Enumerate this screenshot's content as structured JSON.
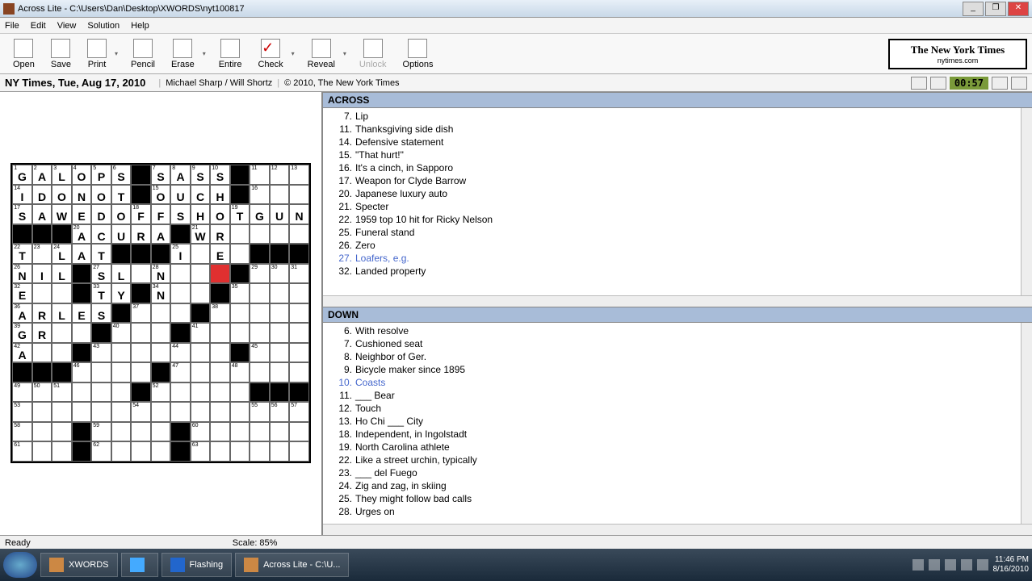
{
  "title": "Across Lite - C:\\Users\\Dan\\Desktop\\XWORDS\\nyt100817",
  "menu": [
    "File",
    "Edit",
    "View",
    "Solution",
    "Help"
  ],
  "tools": {
    "open": "Open",
    "save": "Save",
    "print": "Print",
    "pencil": "Pencil",
    "erase": "Erase",
    "entire": "Entire",
    "check": "Check",
    "reveal": "Reveal",
    "unlock": "Unlock",
    "options": "Options"
  },
  "logo": {
    "top": "The New York Times",
    "sub": "nytimes.com"
  },
  "info": {
    "title": "NY Times, Tue, Aug 17, 2010",
    "author": "Michael Sharp / Will Shortz",
    "copyright": "© 2010, The New York Times",
    "timer": "00:57"
  },
  "across_label": "ACROSS",
  "down_label": "DOWN",
  "across": [
    {
      "n": "7",
      "t": "Lip"
    },
    {
      "n": "11",
      "t": "Thanksgiving side dish"
    },
    {
      "n": "14",
      "t": "Defensive statement"
    },
    {
      "n": "15",
      "t": "\"That hurt!\""
    },
    {
      "n": "16",
      "t": "It's a cinch, in Sapporo"
    },
    {
      "n": "17",
      "t": "Weapon for Clyde Barrow"
    },
    {
      "n": "20",
      "t": "Japanese luxury auto"
    },
    {
      "n": "21",
      "t": "Specter"
    },
    {
      "n": "22",
      "t": "1959 top 10 hit for Ricky Nelson"
    },
    {
      "n": "25",
      "t": "Funeral stand"
    },
    {
      "n": "26",
      "t": "Zero"
    },
    {
      "n": "27",
      "t": "Loafers, e.g.",
      "hl": true
    },
    {
      "n": "32",
      "t": "Landed property"
    }
  ],
  "down": [
    {
      "n": "6",
      "t": "With resolve"
    },
    {
      "n": "7",
      "t": "Cushioned seat"
    },
    {
      "n": "8",
      "t": "Neighbor of Ger."
    },
    {
      "n": "9",
      "t": "Bicycle maker since 1895"
    },
    {
      "n": "10",
      "t": "Coasts",
      "hl": true
    },
    {
      "n": "11",
      "t": "___ Bear"
    },
    {
      "n": "12",
      "t": "Touch"
    },
    {
      "n": "13",
      "t": "Ho Chi ___ City"
    },
    {
      "n": "18",
      "t": "Independent, in Ingolstadt"
    },
    {
      "n": "19",
      "t": "North Carolina athlete"
    },
    {
      "n": "22",
      "t": "Like a street urchin, typically"
    },
    {
      "n": "23",
      "t": "___ del Fuego"
    },
    {
      "n": "24",
      "t": "Zig and zag, in skiing"
    },
    {
      "n": "25",
      "t": "They might follow bad calls"
    },
    {
      "n": "28",
      "t": "Urges on"
    }
  ],
  "grid": [
    [
      {
        "n": "1",
        "l": "G"
      },
      {
        "n": "2",
        "l": "A"
      },
      {
        "n": "3",
        "l": "L"
      },
      {
        "n": "4",
        "l": "O"
      },
      {
        "n": "5",
        "l": "P"
      },
      {
        "n": "6",
        "l": "S"
      },
      {
        "b": 1
      },
      {
        "n": "7",
        "l": "S"
      },
      {
        "n": "8",
        "l": "A"
      },
      {
        "n": "9",
        "l": "S"
      },
      {
        "n": "10",
        "l": "S"
      },
      {
        "b": 1
      },
      {
        "n": "11"
      },
      {
        "n": "12"
      },
      {
        "n": "13"
      }
    ],
    [
      {
        "n": "14",
        "l": "I"
      },
      {
        "l": "D"
      },
      {
        "l": "O"
      },
      {
        "l": "N"
      },
      {
        "l": "O"
      },
      {
        "l": "T"
      },
      {
        "b": 1
      },
      {
        "n": "15",
        "l": "O"
      },
      {
        "l": "U"
      },
      {
        "l": "C"
      },
      {
        "l": "H"
      },
      {
        "b": 1
      },
      {
        "n": "16"
      },
      {},
      {}
    ],
    [
      {
        "n": "17",
        "l": "S"
      },
      {
        "l": "A"
      },
      {
        "l": "W"
      },
      {
        "l": "E"
      },
      {
        "l": "D"
      },
      {
        "l": "O"
      },
      {
        "n": "18",
        "l": "F"
      },
      {
        "l": "F"
      },
      {
        "l": "S"
      },
      {
        "l": "H"
      },
      {
        "l": "O"
      },
      {
        "n": "19",
        "l": "T"
      },
      {
        "l": "G"
      },
      {
        "l": "U"
      },
      {
        "l": "N"
      }
    ],
    [
      {
        "b": 1
      },
      {
        "b": 1
      },
      {
        "b": 1
      },
      {
        "n": "20",
        "l": "A"
      },
      {
        "l": "C"
      },
      {
        "l": "U"
      },
      {
        "l": "R"
      },
      {
        "l": "A"
      },
      {
        "b": 1
      },
      {
        "n": "21",
        "l": "W"
      },
      {
        "l": "R"
      },
      {},
      {},
      {},
      {}
    ],
    [
      {
        "n": "22",
        "l": "T"
      },
      {
        "n": "23"
      },
      {
        "n": "24",
        "l": "L"
      },
      {
        "l": "A"
      },
      {
        "l": "T"
      },
      {
        "b": 1
      },
      {
        "b": 1
      },
      {
        "b": 1
      },
      {
        "n": "25",
        "l": "I"
      },
      {},
      {
        "l": "E"
      },
      {},
      {
        "b": 1
      },
      {
        "b": 1
      },
      {
        "b": 1
      }
    ],
    [
      {
        "n": "26",
        "l": "N"
      },
      {
        "l": "I"
      },
      {
        "l": "L"
      },
      {
        "b": 1
      },
      {
        "n": "27",
        "l": "S"
      },
      {
        "l": "L"
      },
      {},
      {
        "n": "28",
        "l": "N"
      },
      {},
      {},
      {
        "c": 1
      },
      {
        "b": 1
      },
      {
        "n": "29"
      },
      {
        "n": "30"
      },
      {
        "n": "31"
      }
    ],
    [
      {
        "n": "32",
        "l": "E"
      },
      {},
      {},
      {
        "b": 1
      },
      {
        "n": "33",
        "l": "T"
      },
      {
        "l": "Y"
      },
      {
        "b": 1
      },
      {
        "n": "34",
        "l": "N"
      },
      {},
      {},
      {
        "b": 1
      },
      {
        "n": "35"
      },
      {},
      {},
      {}
    ],
    [
      {
        "n": "36",
        "l": "A"
      },
      {
        "l": "R"
      },
      {
        "l": "L"
      },
      {
        "l": "E"
      },
      {
        "l": "S"
      },
      {
        "b": 1
      },
      {
        "n": "37"
      },
      {},
      {},
      {
        "b": 1
      },
      {
        "n": "38"
      },
      {},
      {},
      {},
      {}
    ],
    [
      {
        "n": "39",
        "l": "G"
      },
      {
        "l": "R"
      },
      {},
      {},
      {
        "b": 1
      },
      {
        "n": "40"
      },
      {},
      {},
      {
        "b": 1
      },
      {
        "n": "41"
      },
      {},
      {},
      {},
      {},
      {}
    ],
    [
      {
        "n": "42",
        "l": "A"
      },
      {},
      {},
      {
        "b": 1
      },
      {
        "n": "43"
      },
      {},
      {},
      {},
      {
        "n": "44"
      },
      {},
      {},
      {
        "b": 1
      },
      {
        "n": "45"
      },
      {},
      {}
    ],
    [
      {
        "b": 1
      },
      {
        "b": 1
      },
      {
        "b": 1
      },
      {
        "n": "46"
      },
      {},
      {},
      {},
      {
        "b": 1
      },
      {
        "n": "47"
      },
      {},
      {},
      {
        "n": "48"
      },
      {},
      {},
      {}
    ],
    [
      {
        "n": "49"
      },
      {
        "n": "50"
      },
      {
        "n": "51"
      },
      {},
      {},
      {},
      {
        "b": 1
      },
      {
        "n": "52"
      },
      {},
      {},
      {},
      {},
      {
        "b": 1
      },
      {
        "b": 1
      },
      {
        "b": 1
      }
    ],
    [
      {
        "n": "53"
      },
      {},
      {},
      {},
      {},
      {},
      {
        "n": "54"
      },
      {},
      {},
      {},
      {},
      {},
      {
        "n": "55"
      },
      {
        "n": "56"
      },
      {
        "n": "57"
      }
    ],
    [
      {
        "n": "58"
      },
      {},
      {},
      {
        "b": 1
      },
      {
        "n": "59"
      },
      {},
      {},
      {},
      {
        "b": 1
      },
      {
        "n": "60"
      },
      {},
      {},
      {},
      {},
      {}
    ],
    [
      {
        "n": "61"
      },
      {},
      {},
      {
        "b": 1
      },
      {
        "n": "62"
      },
      {},
      {},
      {},
      {
        "b": 1
      },
      {
        "n": "63"
      },
      {},
      {},
      {},
      {},
      {}
    ]
  ],
  "status": {
    "ready": "Ready",
    "scale": "Scale: 85%"
  },
  "taskbar": {
    "items": [
      "XWORDS",
      "",
      "Flashing",
      "Across Lite - C:\\U..."
    ],
    "time": "11:46 PM",
    "date": "8/16/2010"
  }
}
